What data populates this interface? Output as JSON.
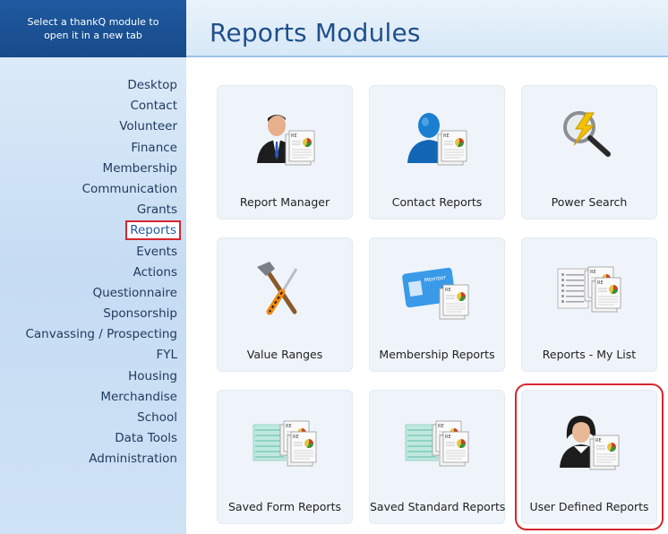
{
  "sidebar": {
    "header_line1": "Select a thankQ module to",
    "header_line2": "open it in a new tab",
    "items": [
      {
        "label": "Desktop"
      },
      {
        "label": "Contact"
      },
      {
        "label": "Volunteer"
      },
      {
        "label": "Finance"
      },
      {
        "label": "Membership"
      },
      {
        "label": "Communication"
      },
      {
        "label": "Grants"
      },
      {
        "label": "Reports",
        "active": true
      },
      {
        "label": "Events"
      },
      {
        "label": "Actions"
      },
      {
        "label": "Questionnaire"
      },
      {
        "label": "Sponsorship"
      },
      {
        "label": "Canvassing / Prospecting"
      },
      {
        "label": "FYL"
      },
      {
        "label": "Housing"
      },
      {
        "label": "Merchandise"
      },
      {
        "label": "School"
      },
      {
        "label": "Data Tools"
      },
      {
        "label": "Administration"
      }
    ]
  },
  "main": {
    "title": "Reports Modules",
    "tiles": [
      {
        "label": "Report Manager",
        "icon": "report-manager-icon"
      },
      {
        "label": "Contact Reports",
        "icon": "contact-reports-icon"
      },
      {
        "label": "Power Search",
        "icon": "power-search-icon"
      },
      {
        "label": "Value Ranges",
        "icon": "value-ranges-icon"
      },
      {
        "label": "Membership Reports",
        "icon": "membership-reports-icon"
      },
      {
        "label": "Reports - My List",
        "icon": "reports-my-list-icon"
      },
      {
        "label": "Saved Form Reports",
        "icon": "saved-form-reports-icon"
      },
      {
        "label": "Saved Standard Reports",
        "icon": "saved-standard-reports-icon"
      },
      {
        "label": "User Defined Reports",
        "icon": "user-defined-reports-icon",
        "highlighted": true
      }
    ]
  },
  "colors": {
    "header_blue": "#1f5aa0",
    "title_blue": "#1f4f8c",
    "highlight_red": "#d7262e",
    "tile_bg": "#eef4fa"
  }
}
